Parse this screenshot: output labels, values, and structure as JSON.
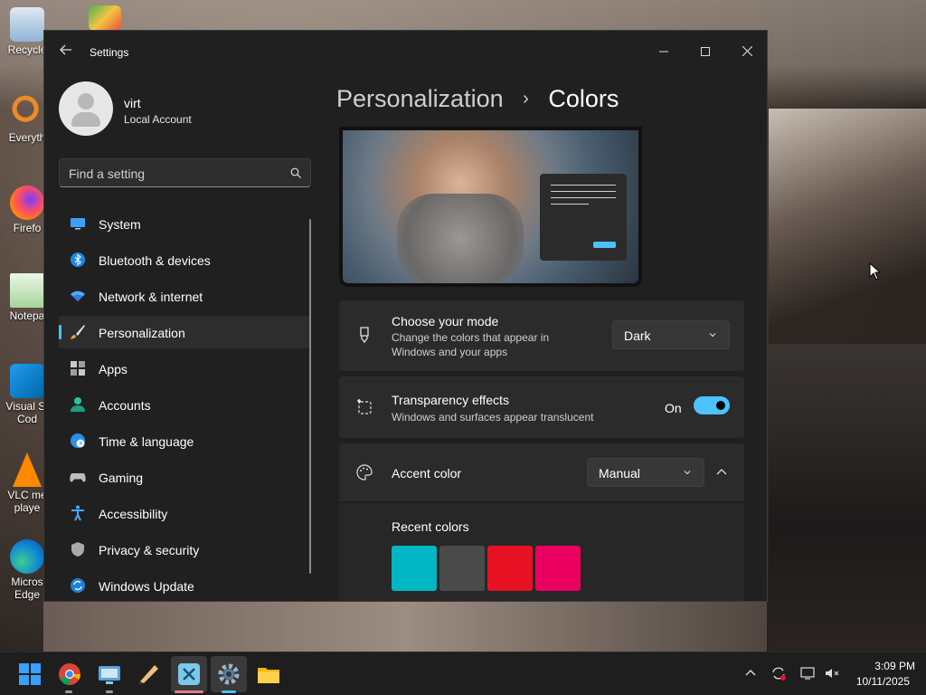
{
  "desktop": {
    "icons": [
      {
        "label": "Recycle",
        "icon": "recycle-bin-icon"
      },
      {
        "label": "Everyth",
        "icon": "everything-search-icon"
      },
      {
        "label": "Firefo",
        "icon": "firefox-icon"
      },
      {
        "label": "Notepa",
        "icon": "notepad-icon"
      },
      {
        "label": "Visual St\nCod",
        "icon": "vscode-icon"
      },
      {
        "label": "VLC me\nplaye",
        "icon": "vlc-icon"
      },
      {
        "label": "Micros\nEdge",
        "icon": "edge-icon"
      }
    ]
  },
  "window": {
    "title": "Settings",
    "user": {
      "name": "virt",
      "account_type": "Local Account"
    },
    "search": {
      "placeholder": "Find a setting"
    },
    "nav": [
      {
        "label": "System",
        "icon": "monitor-icon"
      },
      {
        "label": "Bluetooth & devices",
        "icon": "bluetooth-icon"
      },
      {
        "label": "Network & internet",
        "icon": "wifi-icon"
      },
      {
        "label": "Personalization",
        "icon": "brush-icon",
        "active": true
      },
      {
        "label": "Apps",
        "icon": "apps-icon"
      },
      {
        "label": "Accounts",
        "icon": "person-icon"
      },
      {
        "label": "Time & language",
        "icon": "globe-clock-icon"
      },
      {
        "label": "Gaming",
        "icon": "gamepad-icon"
      },
      {
        "label": "Accessibility",
        "icon": "accessibility-icon"
      },
      {
        "label": "Privacy & security",
        "icon": "shield-icon"
      },
      {
        "label": "Windows Update",
        "icon": "update-icon"
      }
    ],
    "breadcrumb": {
      "parent": "Personalization",
      "separator": "›",
      "current": "Colors"
    },
    "mode": {
      "title": "Choose your mode",
      "description": "Change the colors that appear in Windows and your apps",
      "value": "Dark"
    },
    "transparency": {
      "title": "Transparency effects",
      "description": "Windows and surfaces appear translucent",
      "state_label": "On",
      "enabled": true
    },
    "accent": {
      "title": "Accent color",
      "value": "Manual",
      "recent_title": "Recent colors",
      "recent_colors": [
        "#00b7c3",
        "#4a4a4a",
        "#e81123",
        "#ea005e"
      ]
    }
  },
  "taskbar": {
    "clock_time": "3:09 PM",
    "clock_date": "10/11/2025"
  },
  "colors": {
    "accent": "#4cc2ff",
    "window_bg": "#202020",
    "card_bg": "#2b2b2b"
  }
}
